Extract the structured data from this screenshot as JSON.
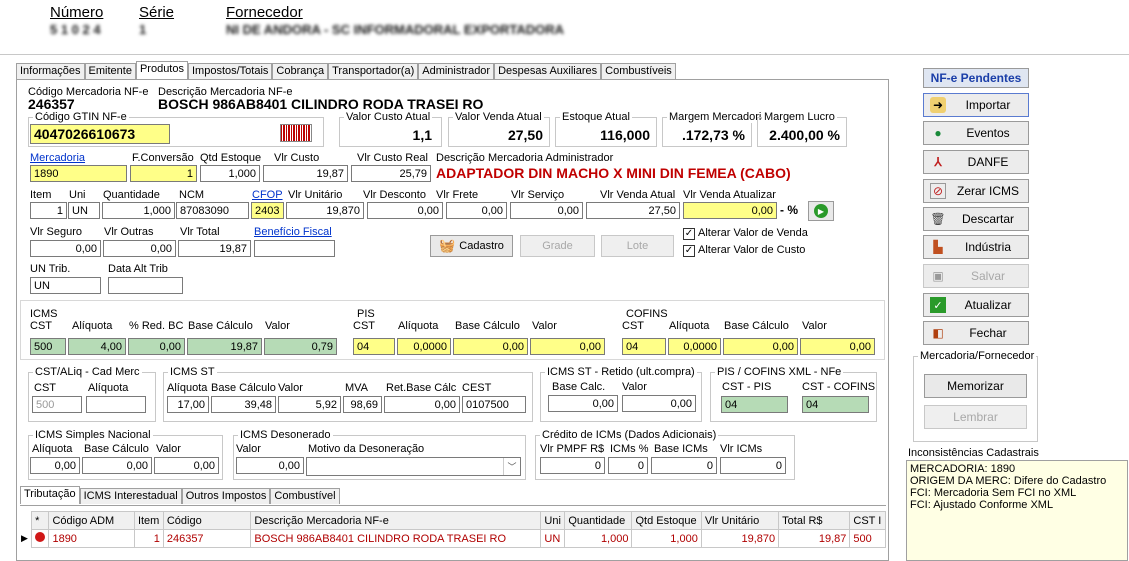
{
  "header": {
    "numero_label": "Número",
    "serie_label": "Série",
    "fornecedor_label": "Fornecedor",
    "numero_value": "5 1 0 2 4",
    "serie_value": "1",
    "fornecedor_value": "NI DE ANDORA - SC INFORMADORAL EXPORTADORA"
  },
  "tabs": [
    "Informações",
    "Emitente",
    "Produtos",
    "Impostos/Totais",
    "Cobrança",
    "Transportador(a)",
    "Administrador",
    "Despesas Auxiliares",
    "Combustíveis"
  ],
  "produto": {
    "cod_merc_label": "Código Mercadoria NF-e",
    "cod_merc": "246357",
    "desc_merc_label": "Descrição Mercadoria NF-e",
    "desc_merc": "BOSCH 986AB8401 CILINDRO RODA TRASEI  RO",
    "gtin_label": "Código GTIN NF-e",
    "gtin": "4047026610673",
    "vlr_custo_atual_label": "Valor Custo Atual",
    "vlr_custo_atual": "1,1",
    "vlr_venda_atual_label": "Valor Venda Atual",
    "vlr_venda_atual": "27,50",
    "estoque_label": "Estoque Atual",
    "estoque": "116,000",
    "margem_merc_label": "Margem Mercadoria",
    "margem_merc": ".172,73 %",
    "margem_lucro_label": "Margem Lucro",
    "margem_lucro": "2.400,00 %",
    "mercadoria_label": "Mercadoria",
    "mercadoria": "1890",
    "fconv_label": "F.Conversão",
    "fconv": "1",
    "qtd_est_label": "Qtd Estoque",
    "qtd_est": "1,000",
    "vlr_custo_label": "Vlr Custo",
    "vlr_custo": "19,87",
    "vlr_custo_real_label": "Vlr Custo Real",
    "vlr_custo_real": "25,79",
    "desc_adm_label": "Descrição Mercadoria Administrador",
    "desc_adm": "ADAPTADOR DIN MACHO X MINI DIN FEMEA (CABO)",
    "item_label": "Item",
    "item": "1",
    "uni_label": "Uni",
    "uni": "UN",
    "qtd_label": "Quantidade",
    "qtd": "1,000",
    "ncm_label": "NCM",
    "ncm": "87083090",
    "cfop_label": "CFOP",
    "cfop": "2403",
    "vlr_unit_label": "Vlr Unitário",
    "vlr_unit": "19,870",
    "vlr_desc_label": "Vlr Desconto",
    "vlr_desc": "0,00",
    "vlr_frete_label": "Vlr Frete",
    "vlr_frete": "0,00",
    "vlr_serv_label": "Vlr Serviço",
    "vlr_serv": "0,00",
    "vlr_venda_atual2_label": "Vlr Venda Atual",
    "vlr_venda_atual2": "27,50",
    "vlr_venda_atualizar_label": "Vlr Venda Atualizar",
    "vlr_venda_atualizar": "0,00",
    "pct": "- %",
    "vlr_seguro_label": "Vlr Seguro",
    "vlr_seguro": "0,00",
    "vlr_outras_label": "Vlr Outras",
    "vlr_outras": "0,00",
    "vlr_total_label": "Vlr Total",
    "vlr_total": "19,87",
    "beneficio_label": "Benefício Fiscal",
    "beneficio": "",
    "cadastro_btn": "Cadastro",
    "grade_btn": "Grade",
    "lote_btn": "Lote",
    "alt_venda": "Alterar Valor de Venda",
    "alt_custo": "Alterar Valor de Custo",
    "un_trib_label": "UN Trib.",
    "un_trib": "UN",
    "data_alt_label": "Data Alt Trib",
    "data_alt": ""
  },
  "icms": {
    "title": "ICMS",
    "cst_l": "CST",
    "aliq_l": "Alíquota",
    "red_l": "% Red. BC",
    "base_l": "Base Cálculo",
    "valor_l": "Valor",
    "cst": "500",
    "aliq": "4,00",
    "red": "0,00",
    "base": "19,87",
    "valor": "0,79"
  },
  "pis": {
    "title": "PIS",
    "cst_l": "CST",
    "aliq_l": "Alíquota",
    "base_l": "Base Cálculo",
    "valor_l": "Valor",
    "cst": "04",
    "aliq": "0,0000",
    "base": "0,00",
    "valor": "0,00"
  },
  "cofins": {
    "title": "COFINS",
    "cst_l": "CST",
    "aliq_l": "Alíquota",
    "base_l": "Base Cálculo",
    "valor_l": "Valor",
    "cst": "04",
    "aliq": "0,0000",
    "base": "0,00",
    "valor": "0,00"
  },
  "cst_cad": {
    "title": "CST/ALiq - Cad Merc",
    "cst_l": "CST",
    "aliq_l": "Alíquota",
    "cst": "500",
    "aliq": ""
  },
  "icms_st": {
    "title": "ICMS ST",
    "aliq_l": "Alíquota",
    "base_l": "Base Cálculo",
    "valor_l": "Valor",
    "mva_l": "MVA",
    "ret_l": "Ret.Base Cálc",
    "cest_l": "CEST",
    "aliq": "17,00",
    "base": "39,48",
    "valor": "5,92",
    "mva": "98,69",
    "ret": "0,00",
    "cest": "0107500"
  },
  "icms_st_ret": {
    "title": "ICMS ST - Retido (ult.compra)",
    "base_l": "Base Calc.",
    "valor_l": "Valor",
    "base": "0,00",
    "valor": "0,00"
  },
  "pis_xml": {
    "title": "PIS / COFINS XML - NFe",
    "cst_pis_l": "CST - PIS",
    "cst_cof_l": "CST - COFINS",
    "cst_pis": "04",
    "cst_cof": "04"
  },
  "simples": {
    "title": "ICMS Simples Nacional",
    "aliq_l": "Alíquota",
    "base_l": "Base Cálculo",
    "valor_l": "Valor",
    "aliq": "0,00",
    "base": "0,00",
    "valor": "0,00"
  },
  "deson": {
    "title": "ICMS Desonerado",
    "valor_l": "Valor",
    "motivo_l": "Motivo da Desoneração",
    "valor": "0,00",
    "motivo": ""
  },
  "credito": {
    "title": "Crédito de ICMs (Dados Adicionais)",
    "pmpf_l": "Vlr PMPF R$",
    "pct_l": "ICMs %",
    "base_l": "Base ICMs",
    "vlr_l": "Vlr ICMs",
    "pmpf": "0",
    "pct": "0",
    "base": "0",
    "vlr": "0"
  },
  "bottom_tabs": [
    "Tributação",
    "ICMS Interestadual",
    "Outros Impostos",
    "Combustível"
  ],
  "grid": {
    "headers": [
      "*",
      "Código ADM",
      "Item",
      "Código",
      "Descrição Mercadoria NF-e",
      "Uni",
      "Quantidade",
      "Qtd Estoque",
      "Vlr Unitário",
      "Total R$",
      "CST I"
    ],
    "row": [
      "",
      "1890",
      "1",
      "246357",
      "BOSCH 986AB8401 CILINDRO RODA TRASEI  RO",
      "UN",
      "1,000",
      "1,000",
      "19,870",
      "19,87",
      "500"
    ]
  },
  "right": {
    "pendentes": "NF-e Pendentes",
    "importar": "Importar",
    "eventos": "Eventos",
    "danfe": "DANFE",
    "zerar": "Zerar ICMS",
    "descartar": "Descartar",
    "industria": "Indústria",
    "salvar": "Salvar",
    "atualizar": "Atualizar",
    "fechar": "Fechar",
    "merc_forn": "Mercadoria/Fornecedor",
    "memorizar": "Memorizar",
    "lembrar": "Lembrar"
  },
  "inconsist": {
    "title": "Inconsistências Cadastrais",
    "lines": [
      "MERCADORIA: 1890",
      "ORIGEM DA MERC: Difere do Cadastro",
      "FCI: Mercadoria Sem FCI no XML",
      "FCI: Ajustado Conforme XML"
    ]
  }
}
